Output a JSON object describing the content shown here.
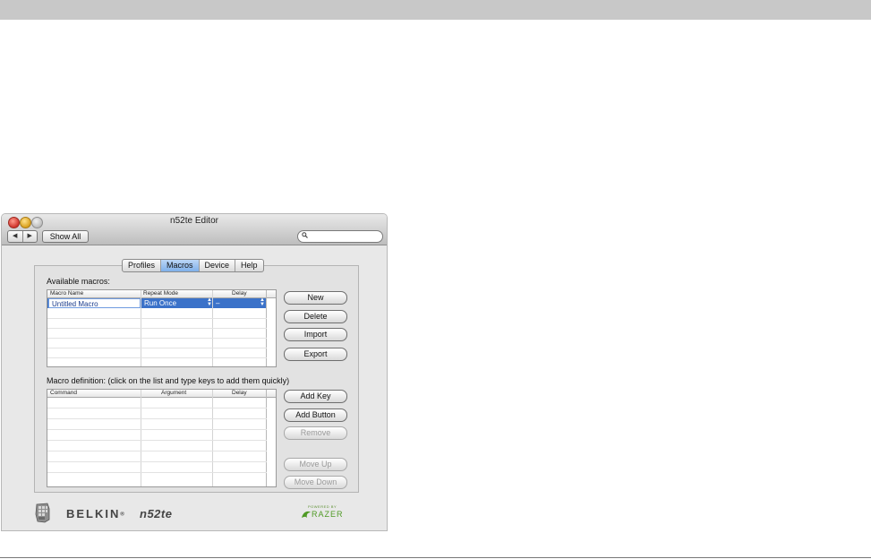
{
  "window": {
    "title": "n52te Editor",
    "back_label": "◀",
    "forward_label": "▶",
    "show_all_label": "Show All",
    "search_placeholder": ""
  },
  "tabs": [
    {
      "label": "Profiles",
      "active": false
    },
    {
      "label": "Macros",
      "active": true
    },
    {
      "label": "Device",
      "active": false
    },
    {
      "label": "Help",
      "active": false
    }
  ],
  "macros": {
    "section_label": "Available macros:",
    "columns": [
      "Macro Name",
      "Repeat Mode",
      "Delay"
    ],
    "rows": [
      {
        "name": "Untitled Macro",
        "repeat_mode": "Run Once",
        "delay": "–"
      }
    ],
    "buttons": {
      "new": "New",
      "delete": "Delete",
      "import": "Import",
      "export": "Export"
    }
  },
  "definition": {
    "section_label": "Macro definition: (click on the list and type keys to add them quickly)",
    "columns": [
      "Command",
      "Argument",
      "Delay"
    ],
    "buttons": {
      "add_key": "Add Key",
      "add_button": "Add Button",
      "remove": "Remove",
      "move_up": "Move Up",
      "move_down": "Move Down"
    }
  },
  "footer": {
    "brand": "BELKIN",
    "brand_mark": "®",
    "product": "n52te",
    "partner_small": "POWERED BY",
    "partner": "RAZER"
  },
  "colors": {
    "selection": "#3b72c9",
    "active_tab": "#7fb0ea",
    "razer_green": "#4f9a25"
  }
}
